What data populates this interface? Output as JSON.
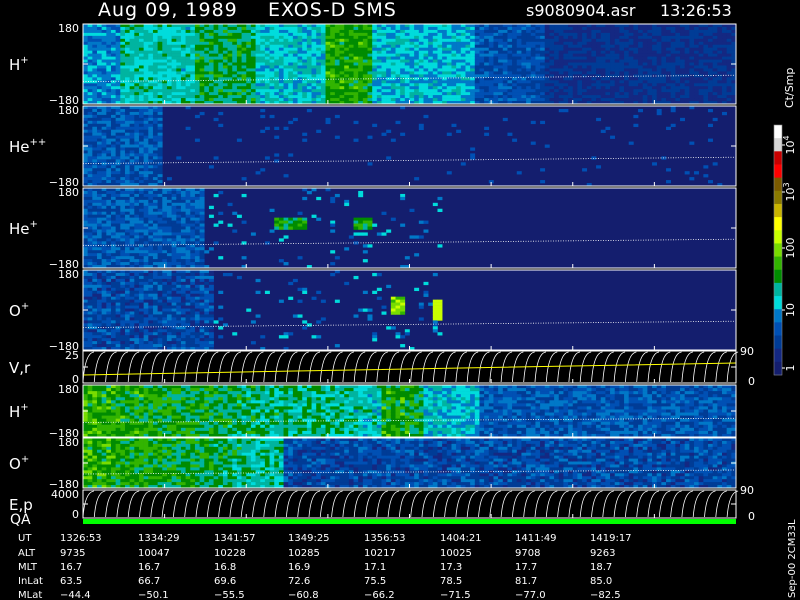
{
  "header": {
    "date": "Aug 09, 1989",
    "instrument": "EXOS-D SMS",
    "file": "s9080904.asr",
    "time": "13:26:53"
  },
  "panels": [
    {
      "id": "h_plus",
      "base": "H",
      "sup": "+",
      "tick_top": "180",
      "tick_bottom": "−180"
    },
    {
      "id": "he_pp",
      "base": "He",
      "sup": "++",
      "tick_top": "180",
      "tick_bottom": "−180"
    },
    {
      "id": "he_plus",
      "base": "He",
      "sup": "+",
      "tick_top": "180",
      "tick_bottom": "−180"
    },
    {
      "id": "o_plus",
      "base": "O",
      "sup": "+",
      "tick_top": "180",
      "tick_bottom": "−180"
    },
    {
      "id": "vr",
      "base": "V,r",
      "sup": "",
      "tick_top": "25",
      "tick_bottom": "0",
      "right_top": "90",
      "right_bottom": "0"
    },
    {
      "id": "h_plus_2",
      "base": "H",
      "sup": "+",
      "tick_top": "180",
      "tick_bottom": "−180"
    },
    {
      "id": "o_plus_2",
      "base": "O",
      "sup": "+",
      "tick_top": "180",
      "tick_bottom": "−180"
    },
    {
      "id": "ep",
      "base": "E,p",
      "sup": "",
      "tick_top": "4000",
      "tick_bottom": "0",
      "right_top": "90",
      "right_bottom": "0"
    }
  ],
  "qa_label": "QA",
  "colorbar": {
    "unit": "Ct/Smp",
    "ticks": [
      {
        "base": "10",
        "exp": "4"
      },
      {
        "base": "10",
        "exp": "3"
      },
      {
        "base": "100",
        "exp": ""
      },
      {
        "base": "10",
        "exp": ""
      },
      {
        "base": "1",
        "exp": ""
      }
    ],
    "colors": [
      "#ffffff",
      "#d7d7d7",
      "#c80000",
      "#ff0000",
      "#7a5a00",
      "#8a7a00",
      "#c8b400",
      "#ffff00",
      "#c8ff00",
      "#78dc00",
      "#32b400",
      "#008c00",
      "#00b4a0",
      "#00dcdc",
      "#0078c8",
      "#0050b4",
      "#003c96",
      "#142882",
      "#141e6e"
    ]
  },
  "orbit": {
    "row_labels": [
      "UT",
      "ALT",
      "MLT",
      "InLat",
      "MLat"
    ],
    "columns": [
      [
        "1326:53",
        "9735",
        "16.7",
        "63.5",
        "−44.4"
      ],
      [
        "1334:29",
        "10047",
        "16.7",
        "66.7",
        "−50.1"
      ],
      [
        "1341:57",
        "10228",
        "16.8",
        "69.6",
        "−55.5"
      ],
      [
        "1349:25",
        "10285",
        "16.9",
        "72.6",
        "−60.8"
      ],
      [
        "1356:53",
        "10217",
        "17.1",
        "75.5",
        "−66.2"
      ],
      [
        "1404:21",
        "10025",
        "17.3",
        "78.5",
        "−71.5"
      ],
      [
        "1411:49",
        "9708",
        "17.7",
        "81.7",
        "−77.0"
      ],
      [
        "1419:17",
        "9263",
        "18.7",
        "85.0",
        "−82.5"
      ]
    ]
  },
  "footer_note": "Sep-00 2CM33L",
  "chart_data": {
    "type": "heatmap",
    "title": "Aug 09, 1989   EXOS-D SMS",
    "file": "s9080904.asr",
    "time": "13:26:53",
    "x_axis": "UT",
    "x_ticks": [
      "1326:53",
      "1334:29",
      "1341:57",
      "1349:25",
      "1356:53",
      "1404:21",
      "1411:49",
      "1419:17"
    ],
    "panels": [
      {
        "species": "H+",
        "ylim": [
          -180,
          180
        ]
      },
      {
        "species": "He++",
        "ylim": [
          -180,
          180
        ]
      },
      {
        "species": "He+",
        "ylim": [
          -180,
          180
        ]
      },
      {
        "species": "O+",
        "ylim": [
          -180,
          180
        ]
      },
      {
        "species": "V,r",
        "ylim": [
          0,
          25
        ],
        "right_ylim": [
          0,
          90
        ]
      },
      {
        "species": "H+",
        "ylim": [
          -180,
          180
        ]
      },
      {
        "species": "O+",
        "ylim": [
          -180,
          180
        ]
      },
      {
        "species": "E,p",
        "ylim": [
          0,
          4000
        ],
        "right_ylim": [
          0,
          90
        ]
      }
    ],
    "colorbar_unit": "Ct/Smp",
    "colorbar_scale": "log",
    "colorbar_range": [
      1,
      10000
    ]
  }
}
